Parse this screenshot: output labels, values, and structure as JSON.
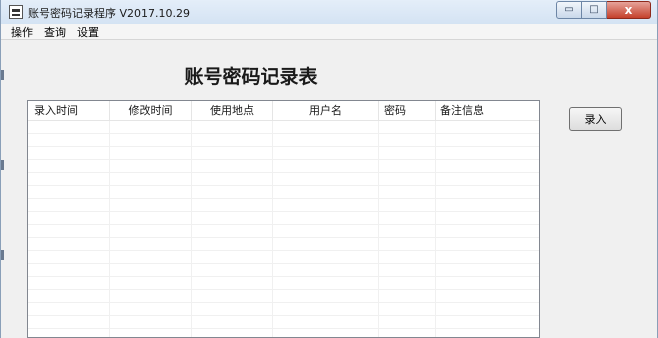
{
  "window": {
    "title": "账号密码记录程序 V2017.10.29",
    "controls": {
      "minimize": "▭",
      "maximize": "□",
      "close": "x"
    }
  },
  "menu": {
    "items": [
      "操作",
      "查询",
      "设置"
    ]
  },
  "main": {
    "heading": "账号密码记录表"
  },
  "table": {
    "columns": [
      "录入时间",
      "修改时间",
      "使用地点",
      "用户名",
      "密码",
      "备注信息"
    ],
    "rows": []
  },
  "actions": {
    "enter_label": "录入"
  }
}
